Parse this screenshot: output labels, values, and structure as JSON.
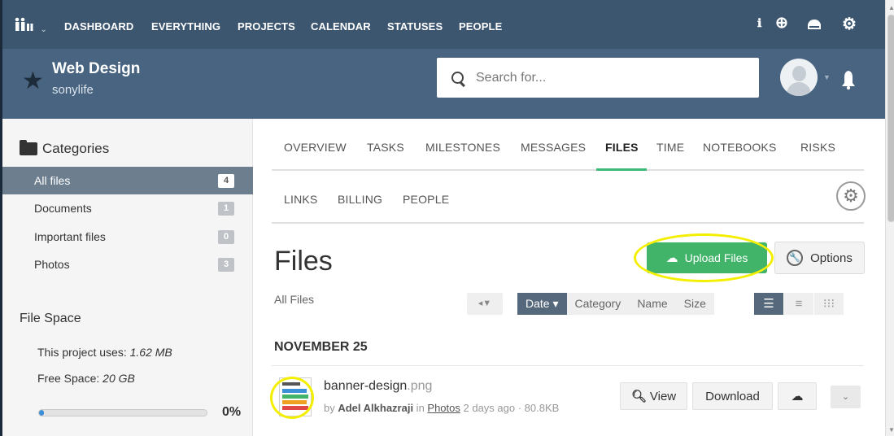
{
  "nav": {
    "items": [
      "DASHBOARD",
      "EVERYTHING",
      "PROJECTS",
      "CALENDAR",
      "STATUSES",
      "PEOPLE"
    ],
    "icons": [
      "info-icon",
      "plus-circle-icon",
      "cloud-drive-icon",
      "gear-icon"
    ]
  },
  "project": {
    "title": "Web Design",
    "subtitle": "sonylife"
  },
  "search": {
    "placeholder": "Search for..."
  },
  "sidebar": {
    "categories_title": "Categories",
    "categories": [
      {
        "label": "All files",
        "count": "4",
        "active": true
      },
      {
        "label": "Documents",
        "count": "1"
      },
      {
        "label": "Important files",
        "count": "0"
      },
      {
        "label": "Photos",
        "count": "3"
      }
    ],
    "file_space_title": "File Space",
    "uses_label": "This project uses: ",
    "uses_value": "1.62 MB",
    "free_label": "Free Space: ",
    "free_value": "20 GB",
    "usage_percent": "0%"
  },
  "tabs": {
    "row1": [
      "OVERVIEW",
      "TASKS",
      "MILESTONES",
      "MESSAGES",
      "FILES",
      "TIME",
      "NOTEBOOKS",
      "RISKS"
    ],
    "row2": [
      "LINKS",
      "BILLING",
      "PEOPLE"
    ],
    "active": "FILES"
  },
  "main": {
    "title": "Files",
    "upload_label": "Upload Files",
    "options_label": "Options",
    "filter_label": "All Files",
    "sort_options": [
      "Date ▾",
      "Category",
      "Name",
      "Size"
    ],
    "date_group": "NOVEMBER 25"
  },
  "file": {
    "name": "banner-design",
    "ext": ".png",
    "by": "by ",
    "author": "Adel Alkhazraji",
    "in": " in ",
    "category": "Photos",
    "meta_tail": " 2 days ago · 80.8KB",
    "view_label": "View",
    "download_label": "Download"
  },
  "colors": {
    "topbar": "#3c5670",
    "header": "#486480",
    "accent_green": "#41b46a",
    "highlight": "#f4ef00"
  }
}
